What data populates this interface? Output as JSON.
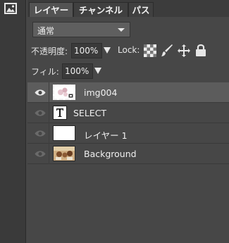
{
  "tabs": [
    {
      "label": "レイヤー",
      "active": true
    },
    {
      "label": "チャンネル",
      "active": false
    },
    {
      "label": "パス",
      "active": false
    }
  ],
  "blend_mode": {
    "value": "通常"
  },
  "opacity": {
    "label": "不透明度:",
    "value": "100%"
  },
  "lock": {
    "label": "Lock:",
    "icons": [
      "transparency-lock-icon",
      "brush-lock-icon",
      "move-lock-icon",
      "padlock-icon"
    ]
  },
  "fill": {
    "label": "フィル:",
    "value": "100%"
  },
  "layers": [
    {
      "name": "img004",
      "selected": true,
      "visible": true,
      "type": "smart-object"
    },
    {
      "name": "SELECT",
      "selected": false,
      "visible": true,
      "type": "text"
    },
    {
      "name": "レイヤー 1",
      "selected": false,
      "visible": true,
      "type": "raster"
    },
    {
      "name": "Background",
      "selected": false,
      "visible": true,
      "type": "image"
    }
  ],
  "colors": {
    "panel_bg": "#474747",
    "selected_row": "#5c5c5c",
    "toolbar_bg": "#3a3a3a"
  }
}
